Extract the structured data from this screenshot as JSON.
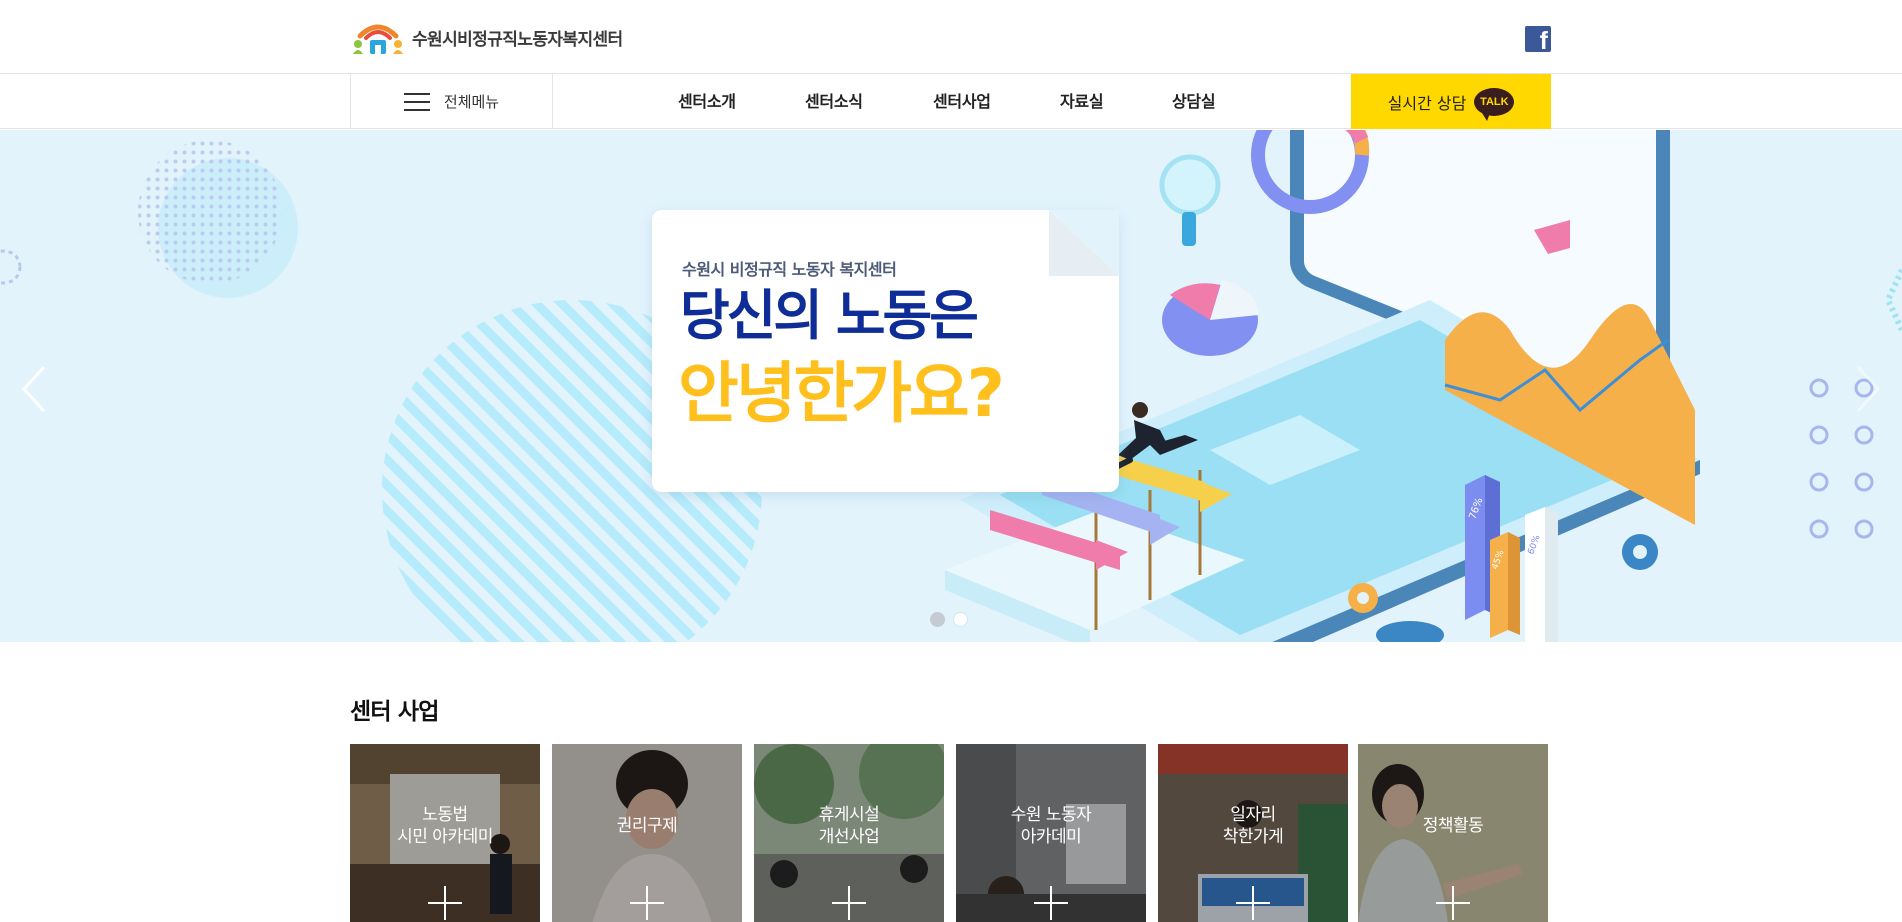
{
  "header": {
    "logo_text": "수원시비정규직노동자복지센터",
    "facebook_icon": "facebook-icon"
  },
  "nav": {
    "all_menu_label": "전체메뉴",
    "items": [
      "센터소개",
      "센터소식",
      "센터사업",
      "자료실",
      "상담실"
    ],
    "talk_label": "실시간 상담",
    "talk_badge": "TALK",
    "talk_color": "#ffd800"
  },
  "hero": {
    "subtitle": "수원시 비정규직 노동자 복지센터",
    "headline_1": "당신의 노동은",
    "headline_2": "안녕한가요?",
    "chart_labels": [
      "76%",
      "45%",
      "60%"
    ],
    "slides_total": 2,
    "active_slide": 1,
    "background_color": "#e2f3fc",
    "headline_1_color": "#0f2d96",
    "headline_2_color": "#ffbf1c"
  },
  "business": {
    "title": "센터 사업",
    "tiles": [
      {
        "label": "노동법\n시민 아카데미"
      },
      {
        "label": "권리구제"
      },
      {
        "label": "휴게시설\n개선사업"
      },
      {
        "label": "수원 노동자\n아카데미"
      },
      {
        "label": "일자리\n착한가게"
      },
      {
        "label": "정책활동"
      }
    ]
  }
}
